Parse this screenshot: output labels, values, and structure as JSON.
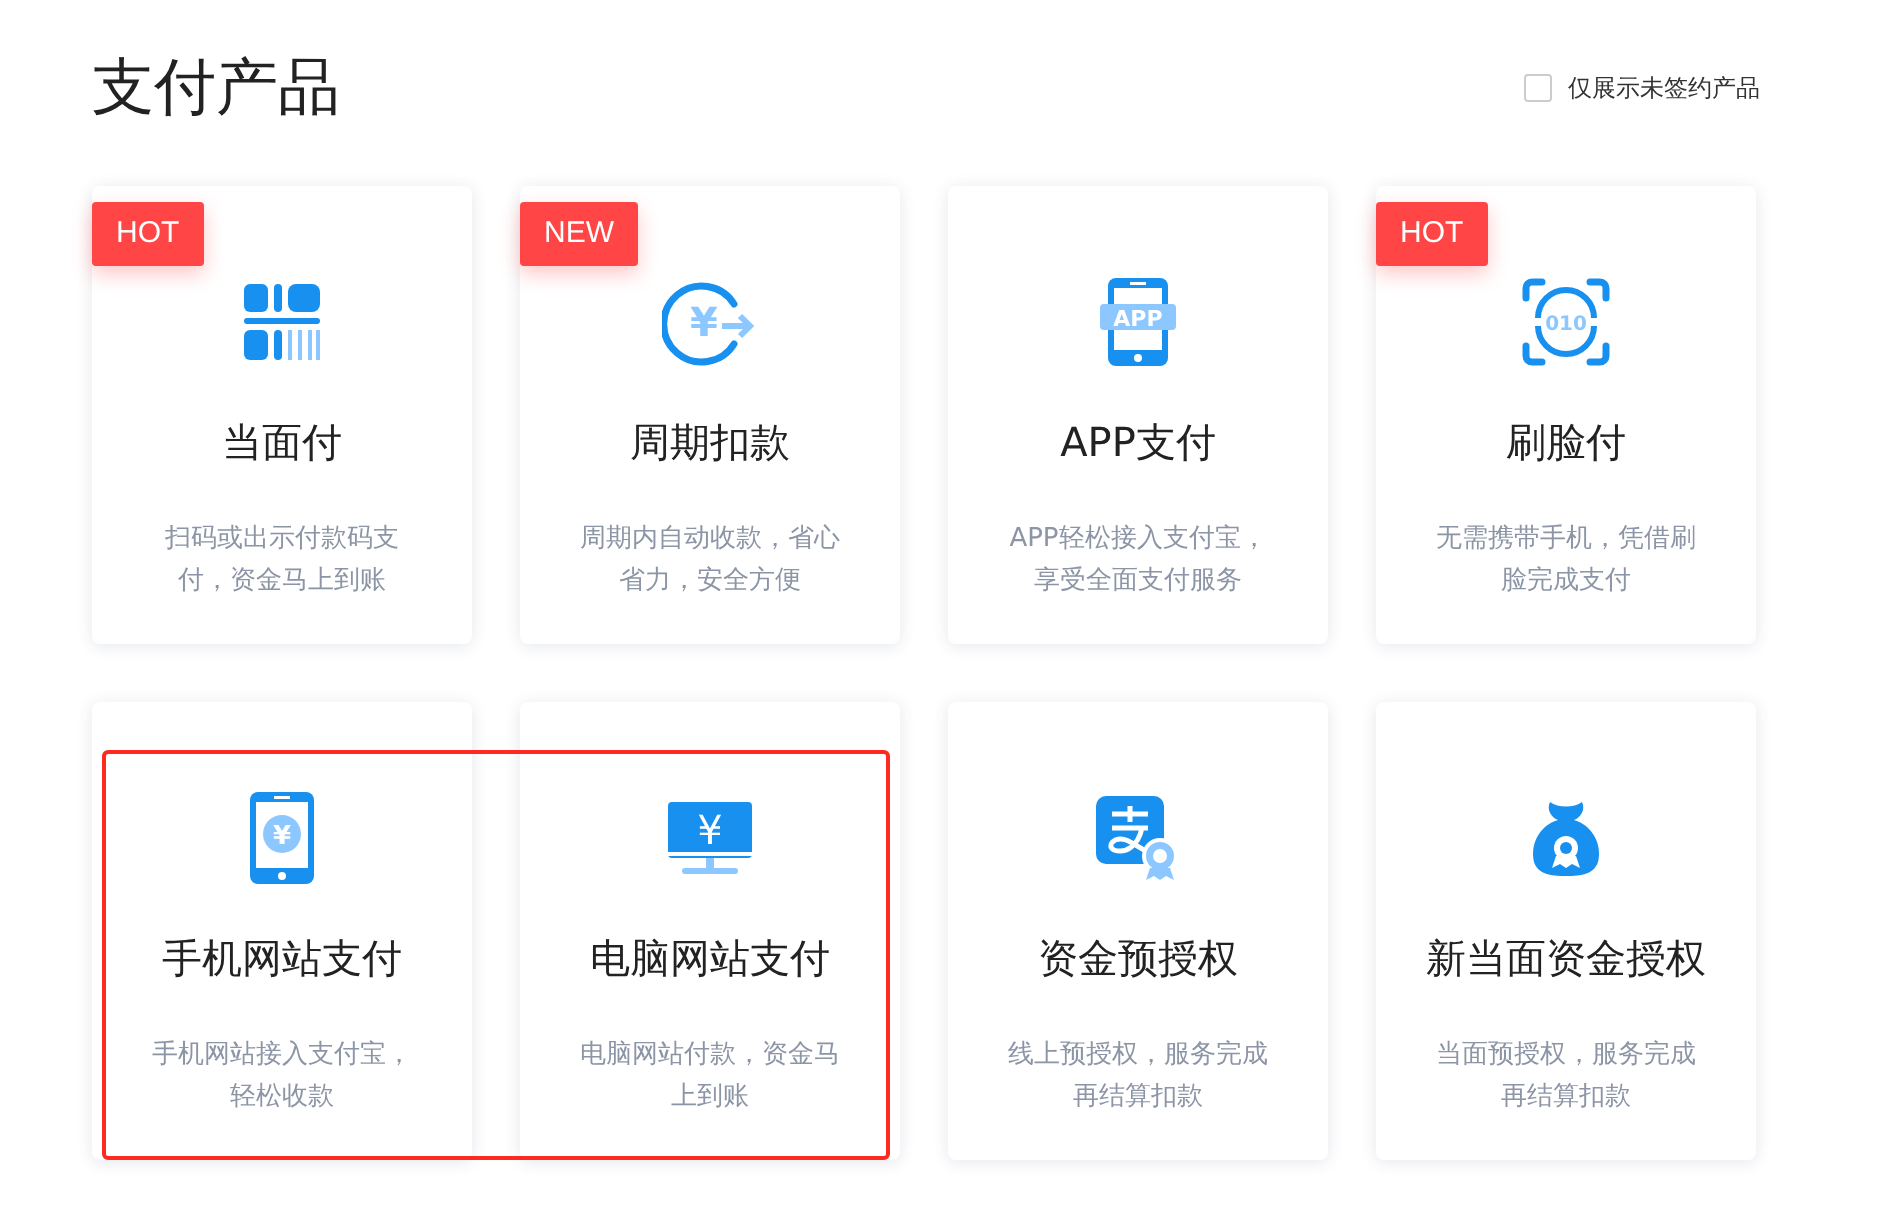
{
  "page": {
    "title": "支付产品"
  },
  "filter": {
    "label": "仅展示未签约产品",
    "checked": false
  },
  "cards": [
    {
      "title": "当面付",
      "badge": "HOT",
      "description": [
        "扫码或出示付款码支",
        "付，资金马上到账"
      ],
      "highlighted": false
    },
    {
      "title": "周期扣款",
      "badge": "NEW",
      "icon_label": "¥",
      "description": [
        "周期内自动收款，省心",
        "省力，安全方便"
      ],
      "highlighted": false
    },
    {
      "title": "APP支付",
      "icon_label": "APP",
      "description": [
        "APP轻松接入支付宝，",
        "享受全面支付服务"
      ],
      "highlighted": false
    },
    {
      "title": "刷脸付",
      "badge": "HOT",
      "icon_label": "010",
      "description": [
        "无需携带手机，凭借刷",
        "脸完成支付"
      ],
      "highlighted": false
    },
    {
      "title": "手机网站支付",
      "icon_label": "¥",
      "description": [
        "手机网站接入支付宝，",
        "轻松收款"
      ],
      "highlighted": true
    },
    {
      "title": "电脑网站支付",
      "icon_label": "¥",
      "description": [
        "电脑网站付款，资金马",
        "上到账"
      ],
      "highlighted": true
    },
    {
      "title": "资金预授权",
      "description": [
        "线上预授权，服务完成",
        "再结算扣款"
      ],
      "highlighted": false
    },
    {
      "title": "新当面资金授权",
      "description": [
        "当面预授权，服务完成",
        "再结算扣款"
      ],
      "highlighted": false
    }
  ]
}
